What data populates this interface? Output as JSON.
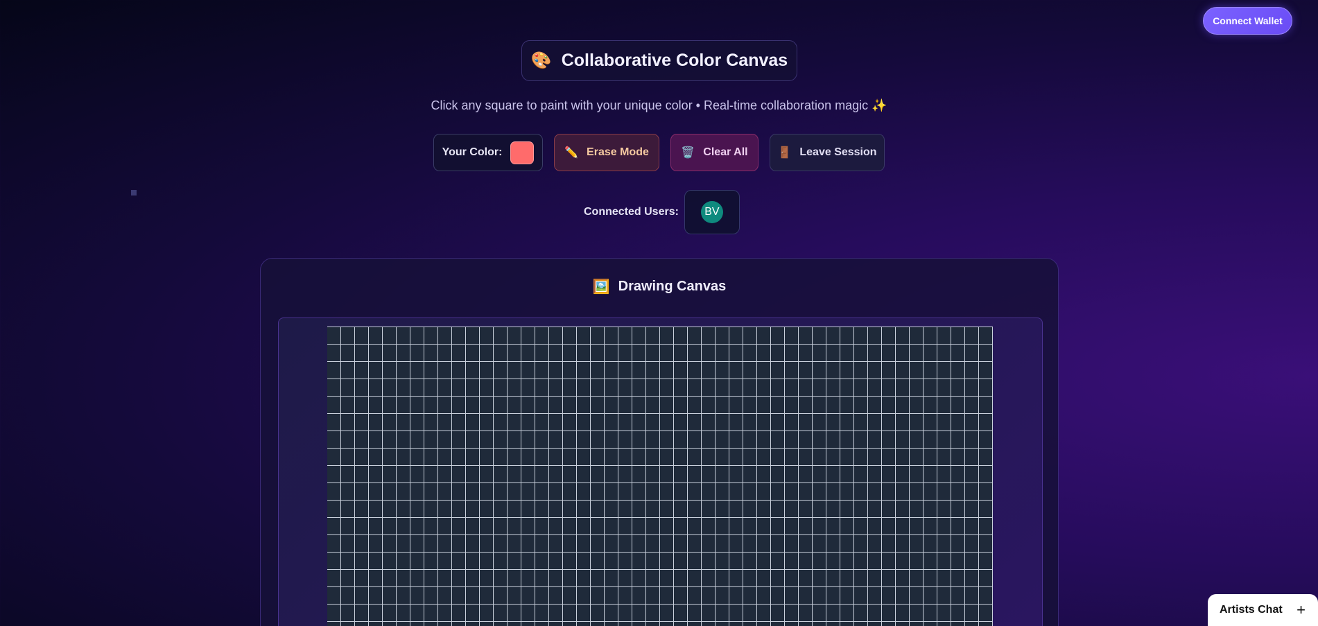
{
  "header": {
    "connect_wallet_label": "Connect Wallet",
    "title_icon": "🎨",
    "title": "Collaborative Color Canvas",
    "subtitle": "Click any square to paint with your unique color • Real-time collaboration magic ✨"
  },
  "toolbar": {
    "your_color_label": "Your Color:",
    "your_color_value": "#ff6b6b",
    "erase_icon": "✏️",
    "erase_label": "Erase Mode",
    "clear_icon": "🗑️",
    "clear_label": "Clear All",
    "leave_icon": "🚪",
    "leave_label": "Leave Session"
  },
  "users": {
    "label": "Connected Users:",
    "list": [
      {
        "initials": "BV",
        "color": "#0f8a7e"
      }
    ]
  },
  "canvas": {
    "title_icon": "🖼️",
    "title": "Drawing Canvas",
    "cell_color": "#1f2a3a",
    "grid_line_color": "#c9d0dc"
  },
  "chat": {
    "label": "Artists Chat",
    "toggle_icon": "+"
  }
}
